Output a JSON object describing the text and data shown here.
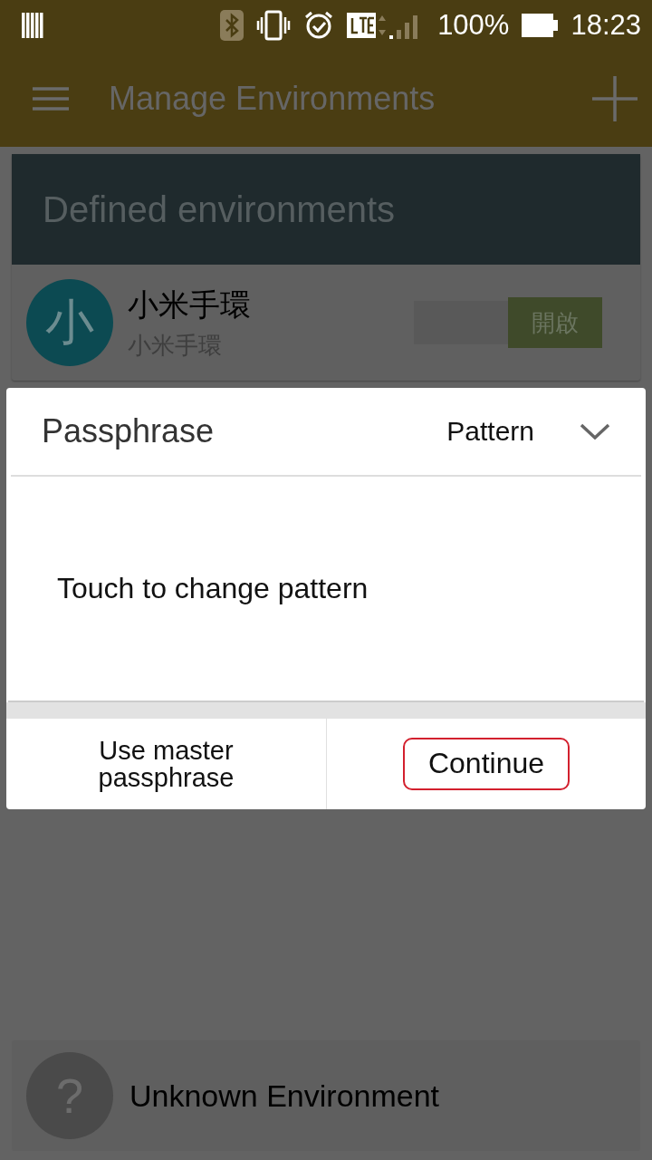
{
  "status_bar": {
    "battery": "100%",
    "time": "18:23"
  },
  "app_bar": {
    "title": "Manage Environments"
  },
  "section": {
    "title": "Defined environments"
  },
  "environments": [
    {
      "avatar": "小",
      "name": "小米手環",
      "subtitle": "小米手環",
      "toggle": {
        "label": "開啟",
        "on": true
      }
    }
  ],
  "dialog": {
    "title": "Passphrase",
    "mode": "Pattern",
    "message": "Touch to change pattern",
    "buttons": [
      {
        "label": "Use master passphrase",
        "highlighted": false
      },
      {
        "label": "Continue",
        "highlighted": true
      }
    ]
  },
  "unknown": {
    "avatar": "?",
    "name": "Unknown Environment"
  }
}
